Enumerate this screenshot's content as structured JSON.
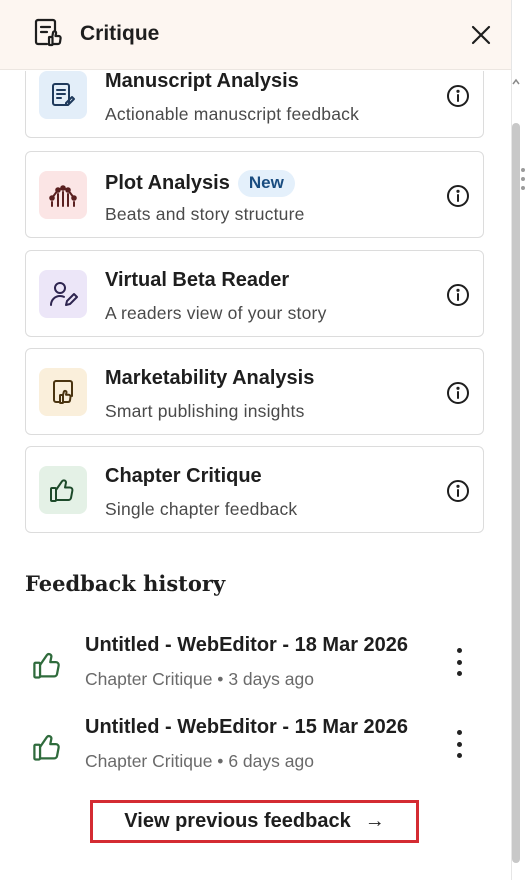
{
  "header": {
    "title": "Critique",
    "logo_icon": "critique-logo-icon",
    "close_icon": "close-icon"
  },
  "tools": [
    {
      "name": "Manuscript Analysis",
      "desc": "Actionable manuscript feedback",
      "badge": "",
      "icon": "manuscript-icon",
      "icon_bg": "#e3eef9",
      "icon_color": "#1f3a5c"
    },
    {
      "name": "Plot Analysis",
      "desc": "Beats and story structure",
      "badge": "New",
      "icon": "plot-chart-icon",
      "icon_bg": "#fbe5e5",
      "icon_color": "#5a2020"
    },
    {
      "name": "Virtual Beta Reader",
      "desc": "A readers view of your story",
      "badge": "",
      "icon": "beta-reader-icon",
      "icon_bg": "#ece6f8",
      "icon_color": "#2e2550"
    },
    {
      "name": "Marketability Analysis",
      "desc": "Smart publishing insights",
      "badge": "",
      "icon": "marketability-icon",
      "icon_bg": "#faefdb",
      "icon_color": "#4a3410"
    },
    {
      "name": "Chapter Critique",
      "desc": "Single chapter feedback",
      "badge": "",
      "icon": "thumbs-up-icon",
      "icon_bg": "#e4f1e6",
      "icon_color": "#1d4a2a"
    }
  ],
  "history": {
    "title": "Feedback history",
    "items": [
      {
        "title": "Untitled - WebEditor - 18 Mar 2026",
        "tool": "Chapter Critique",
        "sep": "•",
        "age": "3 days ago"
      },
      {
        "title": "Untitled - WebEditor - 15 Mar 2026",
        "tool": "Chapter Critique",
        "sep": "•",
        "age": "6 days ago"
      }
    ],
    "view_more": "View previous feedback",
    "arrow": "→"
  },
  "colors": {
    "header_bg": "#fdf6f1",
    "history_icon": "#2f6b3c",
    "highlight_border": "#d42b32"
  }
}
